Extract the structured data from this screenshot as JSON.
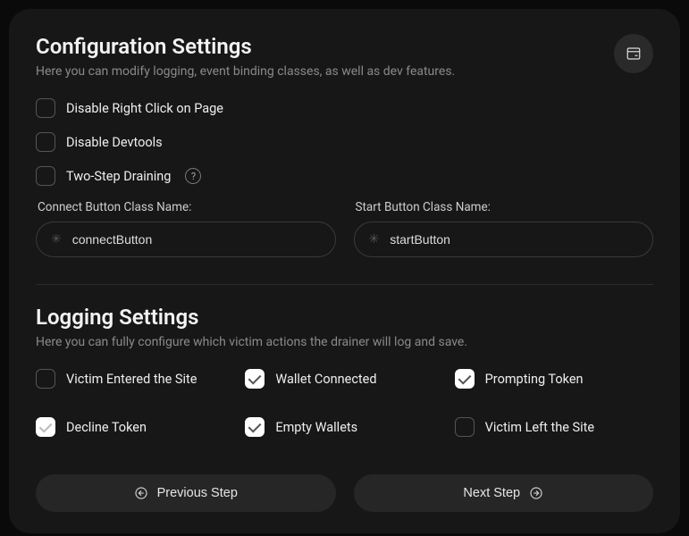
{
  "config": {
    "title": "Configuration Settings",
    "subtitle": "Here you can modify logging, event binding classes, as well as dev features.",
    "options": [
      {
        "label": "Disable Right Click on Page",
        "checked": false,
        "help": false
      },
      {
        "label": "Disable Devtools",
        "checked": false,
        "help": false
      },
      {
        "label": "Two-Step Draining",
        "checked": false,
        "help": true
      }
    ],
    "fields": {
      "connect": {
        "label": "Connect Button Class Name:",
        "value": "connectButton"
      },
      "start": {
        "label": "Start Button Class Name:",
        "value": "startButton"
      }
    }
  },
  "logging": {
    "title": "Logging Settings",
    "subtitle": "Here you can fully configure which victim actions the drainer will log and save.",
    "options": [
      {
        "label": "Victim Entered the Site",
        "checked": false
      },
      {
        "label": "Wallet Connected",
        "checked": true
      },
      {
        "label": "Prompting Token",
        "checked": true
      },
      {
        "label": "Decline Token",
        "checked": true
      },
      {
        "label": "Empty Wallets",
        "checked": true
      },
      {
        "label": "Victim Left the Site",
        "checked": false
      }
    ]
  },
  "nav": {
    "prev": "Previous Step",
    "next": "Next Step"
  }
}
